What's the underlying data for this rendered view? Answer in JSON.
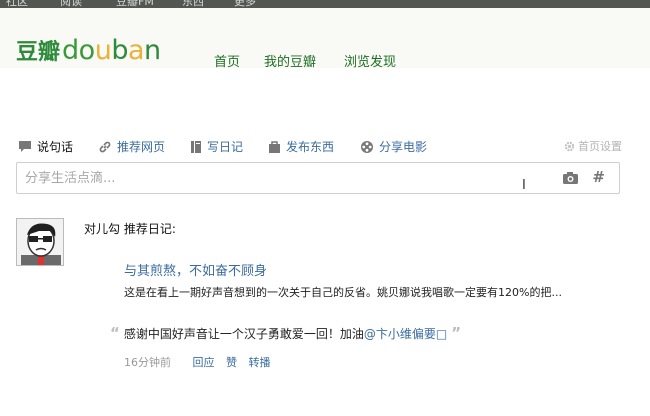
{
  "topbar": {
    "items": [
      "社区",
      "阅读",
      "豆瓣FM",
      "东西",
      "更多"
    ]
  },
  "logo": {
    "cn": "豆瓣",
    "en_parts": [
      "d",
      "o",
      "u",
      "b",
      "a",
      "n"
    ]
  },
  "nav": {
    "items": [
      "首页",
      "我的豆瓣",
      "浏览发现"
    ]
  },
  "toolbar": {
    "items": [
      {
        "label": "说句话",
        "icon": "speech-bubble-icon"
      },
      {
        "label": "推荐网页",
        "icon": "link-icon"
      },
      {
        "label": "写日记",
        "icon": "book-icon"
      },
      {
        "label": "发布东西",
        "icon": "bag-icon"
      },
      {
        "label": "分享电影",
        "icon": "film-reel-icon"
      }
    ],
    "settings": "首页设置"
  },
  "share": {
    "placeholder": "分享生活点滴..."
  },
  "feed": {
    "user": "对儿勾",
    "action": "推荐日记:",
    "title": "与其煎熬，不如奋不顾身",
    "excerpt": "这是在看上一期好声音想到的一次关于自己的反省。姚贝娜说我唱歌一定要有120%的把...",
    "quote_text": "感谢中国好声音让一个汉子勇敢爱一回！加油",
    "mention": "@卞小维偏要□",
    "time": "16分钟前",
    "actions": [
      "回应",
      "赞",
      "转播"
    ]
  },
  "colors": {
    "brand_green": "#2e8b3a",
    "link_blue": "#3b6ca1",
    "topbar": "#545652"
  }
}
